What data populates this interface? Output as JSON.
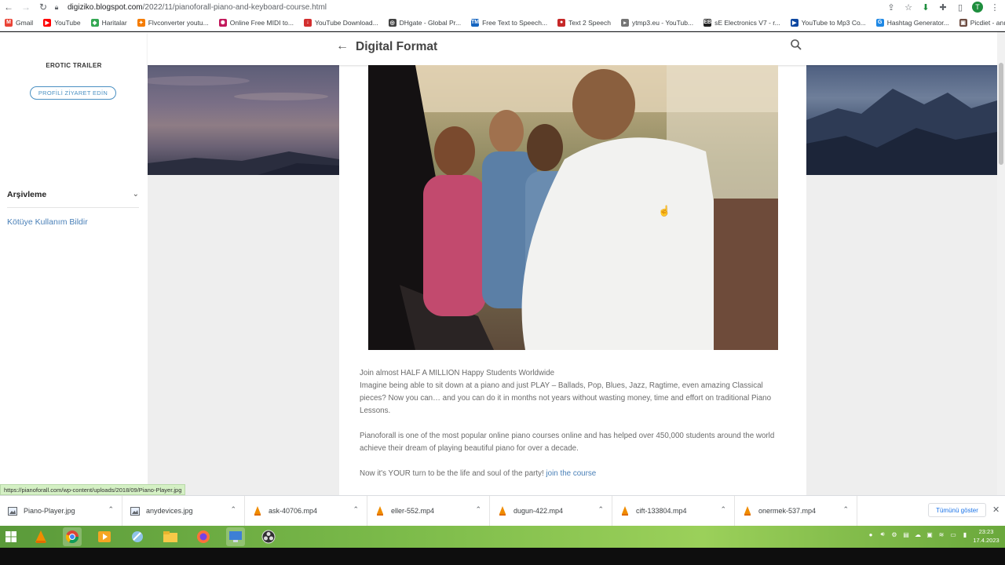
{
  "browser": {
    "url_host": "digiziko.blogspot.com",
    "url_path": "/2022/11/pianoforall-piano-and-keyboard-course.html",
    "profile_initial": "T",
    "bookmarks": [
      {
        "label": "Gmail",
        "icon": "gmail-icon",
        "color": "#ea4335",
        "glyph": "M"
      },
      {
        "label": "YouTube",
        "icon": "youtube-icon",
        "color": "#ff0000",
        "glyph": "▶"
      },
      {
        "label": "Haritalar",
        "icon": "maps-icon",
        "color": "#34a853",
        "glyph": "◆"
      },
      {
        "label": "Flvconverter youtu...",
        "icon": "flvconverter-icon",
        "color": "#f57c00",
        "glyph": "✦"
      },
      {
        "label": "Online Free MIDI to...",
        "icon": "midi-icon",
        "color": "#c2185b",
        "glyph": "✺"
      },
      {
        "label": "YouTube Download...",
        "icon": "yt-download-icon",
        "color": "#d32f2f",
        "glyph": "↓"
      },
      {
        "label": "DHgate - Global Pr...",
        "icon": "dhgate-icon",
        "color": "#424242",
        "glyph": "◎"
      },
      {
        "label": "Free Text to Speech...",
        "icon": "tts-icon",
        "color": "#1565c0",
        "glyph": "TM"
      },
      {
        "label": "Text 2 Speech",
        "icon": "text2speech-icon",
        "color": "#c62828",
        "glyph": "●"
      },
      {
        "label": "ytmp3.eu - YouTub...",
        "icon": "ytmp3-icon",
        "color": "#757575",
        "glyph": "▸"
      },
      {
        "label": "sE Electronics V7 - r...",
        "icon": "se-electronics-icon",
        "color": "#212121",
        "glyph": "EB"
      },
      {
        "label": "YouTube to Mp3 Co...",
        "icon": "yt-mp3-icon",
        "color": "#0d47a1",
        "glyph": "▶"
      },
      {
        "label": "Hashtag Generator...",
        "icon": "hashtag-icon",
        "color": "#1e88e5",
        "glyph": "G"
      },
      {
        "label": "Picdiet - anında resi...",
        "icon": "picdiet-icon",
        "color": "#6d4c41",
        "glyph": "▣"
      }
    ]
  },
  "sidebar": {
    "author_name": "EROTIC TRAILER",
    "visit_profile": "PROFİLİ ZİYARET EDİN",
    "archive_label": "Arşivleme",
    "report_abuse": "Kötüye Kullanım Bildir"
  },
  "post": {
    "title": "Digital Format",
    "intro_line": "Join almost HALF A MILLION Happy Students Worldwide",
    "paragraph1": "Imagine being able to sit down at a piano and just PLAY – Ballads, Pop, Blues, Jazz, Ragtime, even amazing Classical pieces? Now you can… and you can do it in months not years without wasting money, time and effort on traditional Piano Lessons.",
    "paragraph2": "Pianoforall is one of the most popular online piano courses online and has helped over 450,000 students around the world achieve their dream of playing beautiful piano for over a decade.",
    "paragraph3_prefix": "Now it's YOUR turn to be the life and soul of the party!",
    "join_link": "join the course"
  },
  "status_url": "https://pianoforall.com/wp-content/uploads/2018/09/Piano-Player.jpg",
  "downloads": {
    "items": [
      {
        "name": "Piano-Player.jpg",
        "icon": "image-file-icon"
      },
      {
        "name": "anydevices.jpg",
        "icon": "image-file-icon"
      },
      {
        "name": "ask-40706.mp4",
        "icon": "vlc-icon"
      },
      {
        "name": "eller-552.mp4",
        "icon": "vlc-icon"
      },
      {
        "name": "dugun-422.mp4",
        "icon": "vlc-icon"
      },
      {
        "name": "cift-133804.mp4",
        "icon": "vlc-icon"
      },
      {
        "name": "onermek-537.mp4",
        "icon": "vlc-icon"
      }
    ],
    "show_all": "Tümünü göster"
  },
  "taskbar": {
    "time": "23:23",
    "date": "17.4.2023"
  },
  "colors": {
    "link": "#4a80b8",
    "taskbar_green": "#7cbb4a"
  }
}
